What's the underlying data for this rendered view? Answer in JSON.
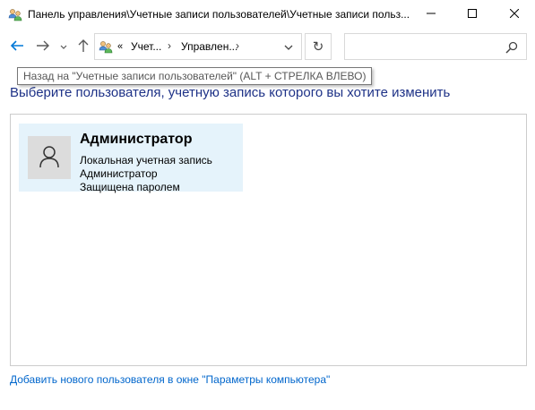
{
  "window": {
    "title": "Панель управления\\Учетные записи пользователей\\Учетные записи польз...",
    "icon": "users-control-panel-icon",
    "minimize_icon": "minimize-icon",
    "maximize_icon": "maximize-icon",
    "close_icon": "close-icon"
  },
  "nav": {
    "back_icon": "arrow-left-icon",
    "forward_icon": "arrow-right-icon",
    "recent_icon": "chevron-down-icon",
    "up_icon": "arrow-up-icon",
    "address": {
      "overflow": "«",
      "segments": [
        "Учет...",
        "Управлен..."
      ],
      "separator": "›"
    },
    "refresh_glyph": "↻",
    "search": {
      "value": "",
      "placeholder": ""
    }
  },
  "tooltip": {
    "text": "Назад на \"Учетные записи пользователей\" (ALT + СТРЕЛКА ВЛЕВО)"
  },
  "main": {
    "heading": "Выберите пользователя, учетную запись которого вы хотите изменить",
    "users": [
      {
        "name": "Администратор",
        "account_type": "Локальная учетная запись",
        "role": "Администратор",
        "password_status": "Защищена паролем",
        "avatar_icon": "user-avatar-icon"
      }
    ],
    "add_user_link": "Добавить нового пользователя в окне \"Параметры компьютера\""
  },
  "colors": {
    "heading": "#1e3287",
    "link": "#0066cc",
    "tile_bg": "#e5f3fb",
    "accent_arrow": "#0078d7"
  }
}
